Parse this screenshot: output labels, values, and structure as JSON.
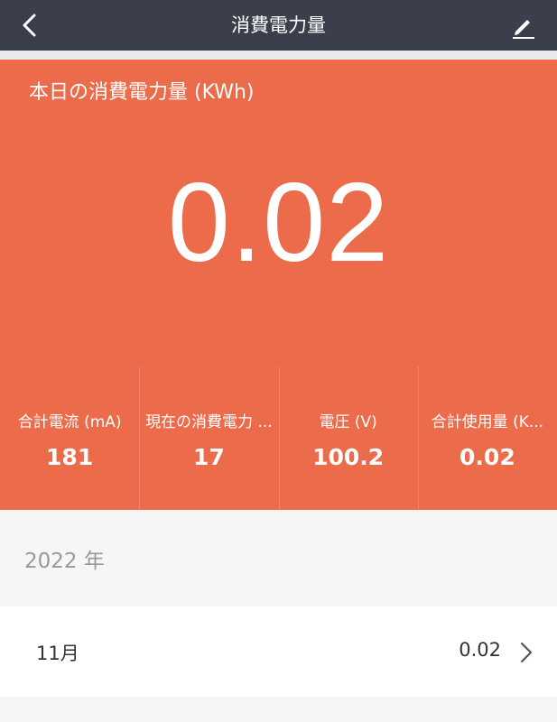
{
  "header": {
    "title": "消費電力量",
    "back_icon": "chevron-left-icon",
    "edit_icon": "pencil-icon"
  },
  "today": {
    "heading": "本日の消費電力量 (KWh)",
    "value": "0.02"
  },
  "stats": [
    {
      "label": "合計電流 (mA)",
      "value": "181"
    },
    {
      "label": "現在の消費電力 ...",
      "value": "17"
    },
    {
      "label": "電圧 (V)",
      "value": "100.2"
    },
    {
      "label": "合計使用量 (K...",
      "value": "0.02"
    }
  ],
  "history": {
    "year": "2022 年",
    "months": [
      {
        "label": "11月",
        "value": "0.02"
      }
    ]
  },
  "colors": {
    "topbar": "#3b3f4c",
    "accent": "#eb6b4b",
    "background": "#f6f6f6"
  }
}
